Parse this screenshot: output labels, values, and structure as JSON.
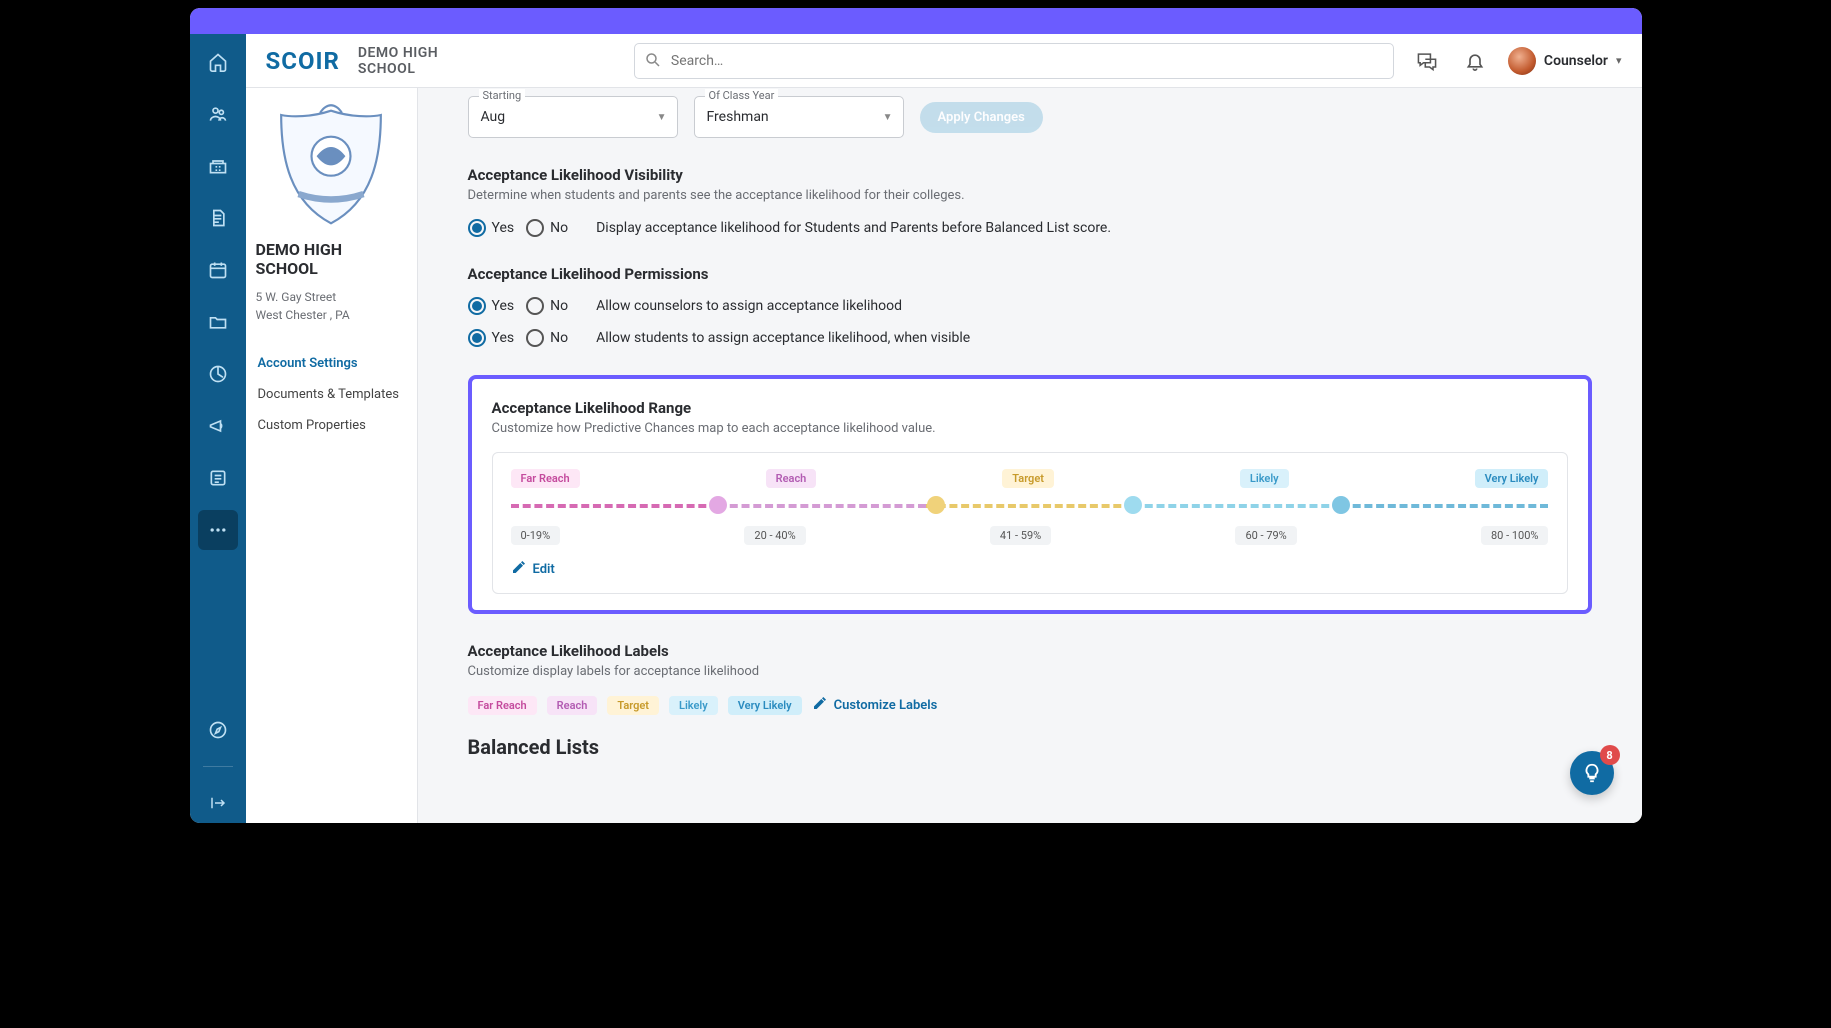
{
  "header": {
    "logo_text": "SCOIR",
    "school": "DEMO HIGH SCHOOL",
    "search_placeholder": "Search…",
    "user_label": "Counselor"
  },
  "sidepanel": {
    "school_name": "DEMO HIGH SCHOOL",
    "address_line1": "5 W. Gay Street",
    "address_line2": "West Chester , PA",
    "links": {
      "l0": "Account Settings",
      "l1": "Documents & Templates",
      "l2": "Custom Properties"
    }
  },
  "form": {
    "starting": {
      "label": "Starting",
      "value": "Aug"
    },
    "classyear": {
      "label": "Of Class Year",
      "value": "Freshman"
    },
    "apply_label": "Apply Changes"
  },
  "sections": {
    "visibility": {
      "title": "Acceptance Likelihood Visibility",
      "desc": "Determine when students and parents see the acceptance likelihood for their colleges.",
      "text": "Display acceptance likelihood for Students and Parents before Balanced List score."
    },
    "permissions": {
      "title": "Acceptance Likelihood Permissions",
      "p1": "Allow counselors to assign acceptance likelihood",
      "p2": "Allow students to assign acceptance likelihood, when visible"
    },
    "range": {
      "title": "Acceptance Likelihood Range",
      "desc": "Customize how Predictive Chances map to each acceptance likelihood value.",
      "labels": {
        "l0": "Far Reach",
        "l1": "Reach",
        "l2": "Target",
        "l3": "Likely",
        "l4": "Very Likely"
      },
      "values": {
        "v0": "0-19%",
        "v1": "20 - 40%",
        "v2": "41 - 59%",
        "v3": "60 - 79%",
        "v4": "80 - 100%"
      },
      "edit": "Edit"
    },
    "labels_section": {
      "title": "Acceptance Likelihood Labels",
      "desc": "Customize display labels for acceptance likelihood",
      "customize": "Customize Labels"
    },
    "balanced": "Balanced Lists"
  },
  "radios": {
    "yes": "Yes",
    "no": "No"
  },
  "help": {
    "badge": "8"
  }
}
